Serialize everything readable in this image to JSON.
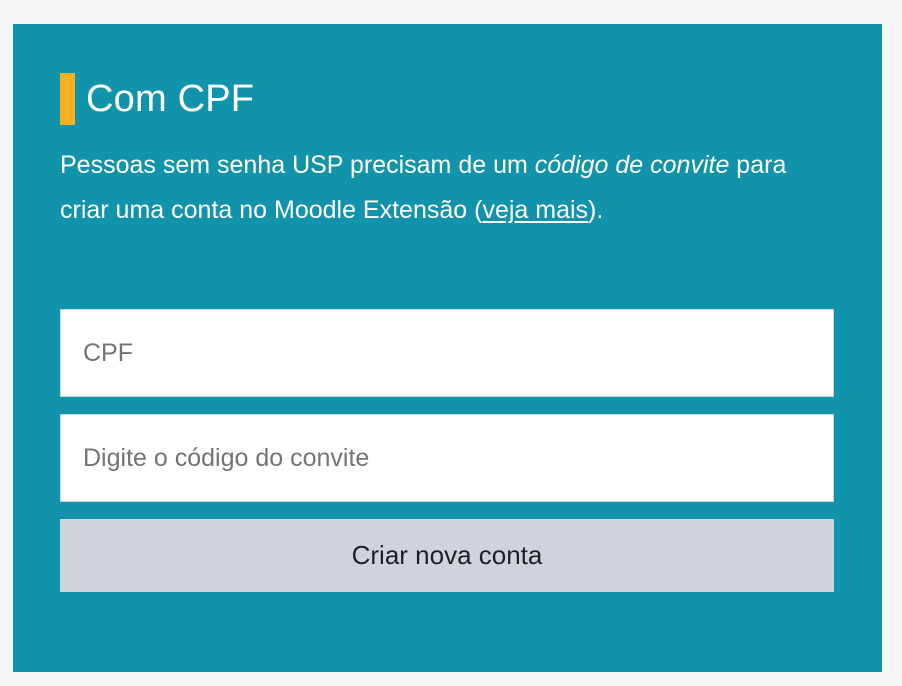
{
  "section": {
    "title": "Com CPF",
    "description": {
      "part1": "Pessoas sem senha USP precisam de um ",
      "emphasis": "código de convite",
      "part2": " para criar uma conta no Moodle Extensão (",
      "link_text": "veja mais",
      "part3": ")."
    }
  },
  "form": {
    "cpf_placeholder": "CPF",
    "cpf_value": "",
    "code_placeholder": "Digite o código do convite",
    "code_value": "",
    "submit_label": "Criar nova conta"
  },
  "colors": {
    "panel_background": "#1193ab",
    "accent": "#f9b21d",
    "button_background": "#ced4da"
  }
}
